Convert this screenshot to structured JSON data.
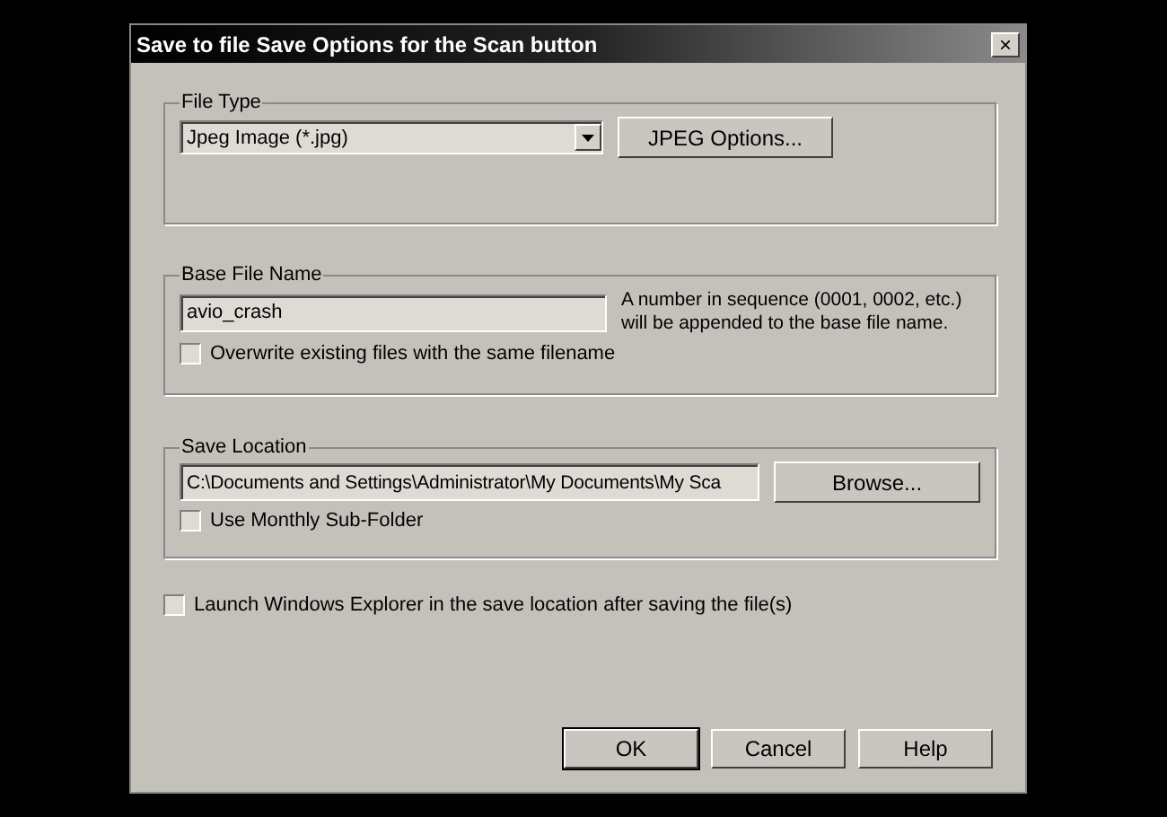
{
  "window": {
    "title": "Save to file Save Options for the Scan button",
    "close": "×"
  },
  "file_type": {
    "label": "File Type",
    "value": "Jpeg Image (*.jpg)",
    "options_button": "JPEG Options..."
  },
  "base_file_name": {
    "label": "Base File Name",
    "value": "avio_crash",
    "note": "A number in sequence (0001, 0002, etc.) will be appended to the base file name.",
    "overwrite": {
      "label": "Overwrite existing files with the same filename",
      "checked": false
    }
  },
  "save_location": {
    "label": "Save Location",
    "value": "C:\\Documents and Settings\\Administrator\\My Documents\\My Sca",
    "browse_button": "Browse...",
    "monthly": {
      "label": "Use Monthly Sub-Folder",
      "checked": false
    }
  },
  "launch_explorer": {
    "label": "Launch Windows Explorer in the save location after saving the file(s)",
    "checked": false
  },
  "buttons": [
    {
      "label": "OK",
      "default": true
    },
    {
      "label": "Cancel",
      "default": false
    },
    {
      "label": "Help",
      "default": false
    }
  ]
}
